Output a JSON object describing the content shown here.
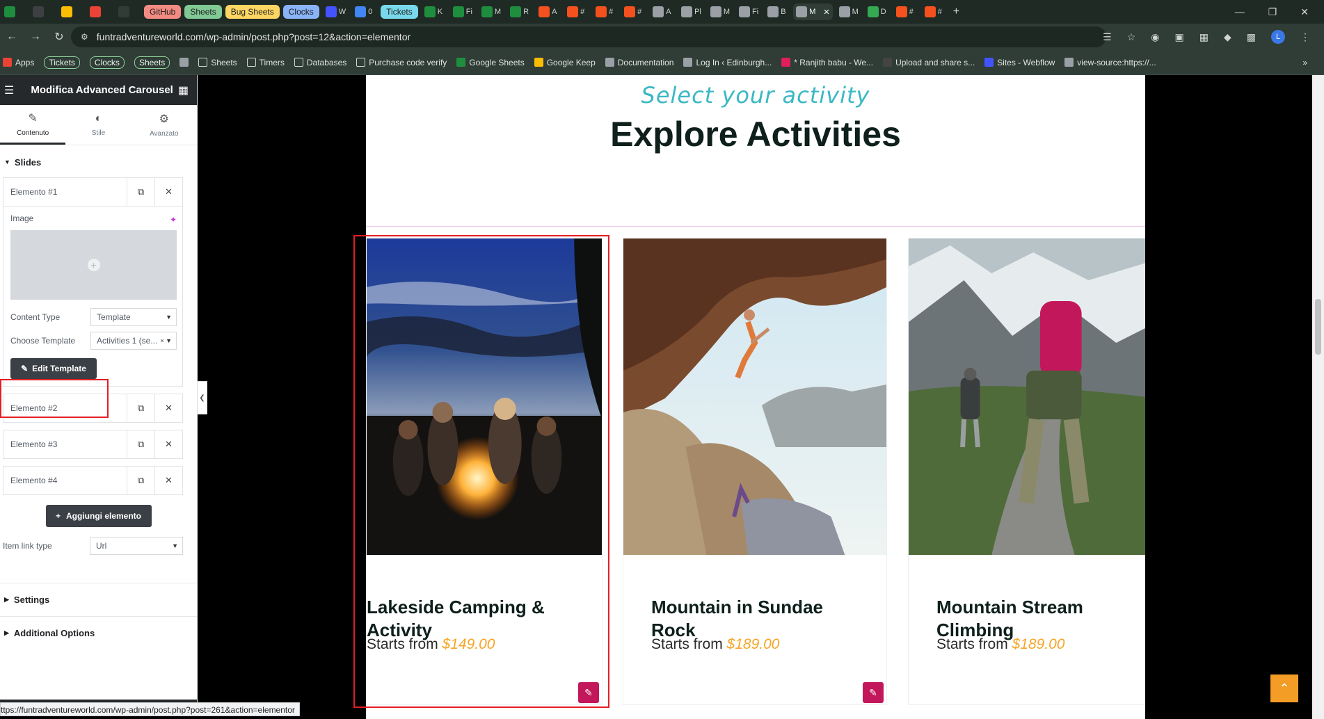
{
  "browser": {
    "tabs": [
      {
        "label": "",
        "icon": "sheets-icon",
        "color": "#1e8e3e",
        "kind": "icon"
      },
      {
        "label": "",
        "icon": "openai-icon",
        "color": "#3c4043",
        "kind": "icon"
      },
      {
        "label": "",
        "icon": "keep-icon",
        "color": "#fbbc04",
        "kind": "icon"
      },
      {
        "label": "",
        "icon": "gmail-icon",
        "color": "#ea4335",
        "kind": "icon"
      },
      {
        "label": "",
        "icon": "blank-icon",
        "color": "#2f3d36",
        "kind": "icon"
      },
      {
        "label": "GitHub",
        "color": "#f28b82",
        "kind": "pill"
      },
      {
        "label": "Sheets",
        "color": "#81c995",
        "kind": "pill"
      },
      {
        "label": "Bug Sheets",
        "color": "#fdd663",
        "kind": "pill"
      },
      {
        "label": "Clocks",
        "color": "#8ab4f8",
        "kind": "pill"
      },
      {
        "label": "W",
        "icon": "webflow-icon",
        "color": "#4353ff",
        "kind": "icon"
      },
      {
        "label": "0",
        "icon": "google-icon",
        "color": "#4285f4",
        "kind": "icon"
      },
      {
        "label": "Tickets",
        "color": "#78d9ec",
        "kind": "pill"
      },
      {
        "label": "K",
        "icon": "sheets-icon",
        "color": "#1e8e3e",
        "kind": "icon"
      },
      {
        "label": "Fi",
        "icon": "sheets-icon",
        "color": "#1e8e3e",
        "kind": "icon"
      },
      {
        "label": "M",
        "icon": "sheets-icon",
        "color": "#1e8e3e",
        "kind": "icon"
      },
      {
        "label": "R",
        "icon": "sheets-icon",
        "color": "#1e8e3e",
        "kind": "icon"
      },
      {
        "label": "A",
        "icon": "ticket-icon",
        "color": "#f4511e",
        "kind": "icon"
      },
      {
        "label": "#",
        "icon": "ticket-icon",
        "color": "#f4511e",
        "kind": "icon"
      },
      {
        "label": "#",
        "icon": "ticket-icon",
        "color": "#f4511e",
        "kind": "icon"
      },
      {
        "label": "#",
        "icon": "ticket-icon",
        "color": "#f4511e",
        "kind": "icon"
      },
      {
        "label": "A",
        "icon": "globe-icon",
        "color": "#9aa0a6",
        "kind": "icon"
      },
      {
        "label": "Pl",
        "icon": "globe-icon",
        "color": "#9aa0a6",
        "kind": "icon"
      },
      {
        "label": "M",
        "icon": "globe-icon",
        "color": "#9aa0a6",
        "kind": "icon"
      },
      {
        "label": "Fi",
        "icon": "globe-icon",
        "color": "#9aa0a6",
        "kind": "icon"
      },
      {
        "label": "B",
        "icon": "globe-icon",
        "color": "#9aa0a6",
        "kind": "icon"
      },
      {
        "label": "M",
        "icon": "globe-icon",
        "color": "#9aa0a6",
        "kind": "active"
      },
      {
        "label": "M",
        "icon": "globe-icon",
        "color": "#9aa0a6",
        "kind": "icon"
      },
      {
        "label": "D",
        "icon": "doc-icon",
        "color": "#34a853",
        "kind": "icon"
      },
      {
        "label": "#",
        "icon": "ticket-icon",
        "color": "#f4511e",
        "kind": "icon"
      },
      {
        "label": "#",
        "icon": "ticket-icon",
        "color": "#f4511e",
        "kind": "icon"
      }
    ],
    "new_tab": "+",
    "url": "funtradventureworld.com/wp-admin/post.php?post=12&action=elementor",
    "bookmarks": [
      {
        "label": "Apps",
        "icon": "apps-icon",
        "kind": "plain"
      },
      {
        "label": "Tickets",
        "kind": "pill"
      },
      {
        "label": "Clocks",
        "kind": "pill"
      },
      {
        "label": "Sheets",
        "kind": "pill"
      },
      {
        "label": "",
        "icon": "grid-icon",
        "kind": "plain"
      },
      {
        "label": "Sheets",
        "icon": "folder-icon",
        "kind": "plain"
      },
      {
        "label": "Timers",
        "icon": "folder-icon",
        "kind": "plain"
      },
      {
        "label": "Databases",
        "icon": "folder-icon",
        "kind": "plain"
      },
      {
        "label": "Purchase code verify",
        "icon": "folder-icon",
        "kind": "plain"
      },
      {
        "label": "Google Sheets",
        "icon": "sheets-icon",
        "kind": "plain"
      },
      {
        "label": "Google Keep",
        "icon": "keep-icon",
        "kind": "plain"
      },
      {
        "label": "Documentation",
        "icon": "globe-icon",
        "kind": "plain"
      },
      {
        "label": "Log In ‹ Edinburgh...",
        "icon": "globe-icon",
        "kind": "plain"
      },
      {
        "label": "* Ranjith babu - We...",
        "icon": "slack-icon",
        "kind": "plain"
      },
      {
        "label": "Upload and share s...",
        "icon": "sb-icon",
        "kind": "plain"
      },
      {
        "label": "Sites - Webflow",
        "icon": "webflow-icon",
        "kind": "plain"
      },
      {
        "label": "view-source:https://...",
        "icon": "globe-icon",
        "kind": "plain"
      }
    ],
    "more_bookmarks": "»",
    "status_url": "ttps://funtradventureworld.com/wp-admin/post.php?post=261&action=elementor"
  },
  "panel": {
    "title": "Modifica Advanced Carousel",
    "tabs": [
      {
        "label": "Contenuto",
        "icon": "pencil-icon",
        "active": true
      },
      {
        "label": "Stile",
        "icon": "contrast-icon",
        "active": false
      },
      {
        "label": "Avanzato",
        "icon": "gear-icon",
        "active": false
      }
    ],
    "section_slides": "Slides",
    "items": [
      "Elemento #1",
      "Elemento #2",
      "Elemento #3",
      "Elemento #4"
    ],
    "image_label": "Image",
    "content_type_label": "Content Type",
    "content_type_value": "Template",
    "choose_template_label": "Choose Template",
    "choose_template_value": "Activities 1 (se...",
    "edit_template": "Edit Template",
    "add_item": "Aggiungi elemento",
    "item_link_type_label": "Item link type",
    "item_link_type_value": "Url",
    "section_settings": "Settings",
    "section_additional": "Additional Options"
  },
  "preview": {
    "subtitle": "Select your activity",
    "heading": "Explore Activities",
    "cards": [
      {
        "title": "Lakeside Camping & Activity",
        "price_prefix": "Starts from",
        "price": "$149.00",
        "image": "campfire"
      },
      {
        "title": "Mountain in Sundae Rock",
        "price_prefix": "Starts from",
        "price": "$189.00",
        "image": "climbing"
      },
      {
        "title": "Mountain Stream Climbing",
        "price_prefix": "Starts from",
        "price": "$189.00",
        "image": "hiking"
      }
    ]
  },
  "colors": {
    "accent_price": "#f7a527",
    "subtitle": "#3ab8c5",
    "edit_icon_bg": "#c2185b",
    "highlight": "#e31e24",
    "scroll_top": "#f39c26"
  }
}
